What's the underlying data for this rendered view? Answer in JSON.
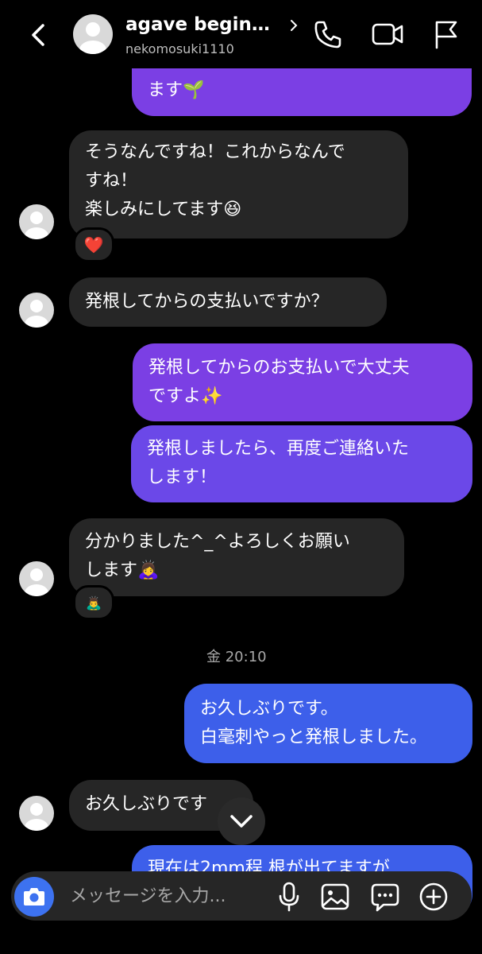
{
  "header": {
    "title": "agave begin…",
    "username": "nekomosuki1110"
  },
  "messages": {
    "m0": "ます🌱",
    "m1_line1": "そうなんですね！これからなんで",
    "m1_line2": "すね！",
    "m1_line3": "楽しみにしてます😆",
    "m1_reaction": "❤️",
    "m2": "発根してからの支払いですか？",
    "m3_line1": "発根してからのお支払いで大丈夫",
    "m3_line2": "ですよ✨",
    "m4_line1": "発根しましたら、再度ご連絡いた",
    "m4_line2": "します！",
    "m5_line1": "分かりました^_^よろしくお願い",
    "m5_line2": "します🙇‍♀️",
    "m5_reaction": "🙇‍♂️",
    "timestamp": "金 20:10",
    "m6_line1": "お久しぶりです。",
    "m6_line2": "白毫刺やっと発根しました。",
    "m7": "お久しぶりです",
    "m8": "現在は2mm程 根が出てますが"
  },
  "composer": {
    "placeholder": "メッセージを入力..."
  }
}
